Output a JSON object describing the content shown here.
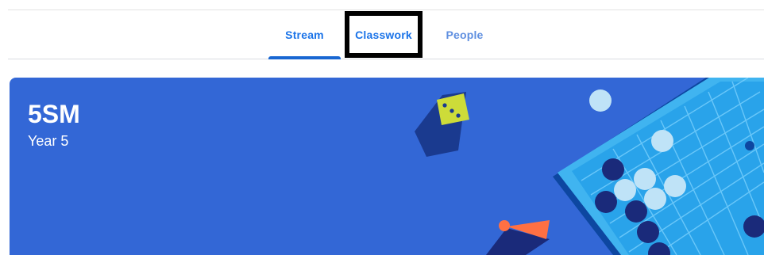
{
  "tabs": [
    {
      "label": "Stream",
      "active": true
    },
    {
      "label": "Classwork",
      "active": false,
      "highlighted": true
    },
    {
      "label": "People",
      "active": false
    }
  ],
  "banner": {
    "title": "5SM",
    "subtitle": "Year 5",
    "background_color": "#3367d6",
    "illustration": "board-game-illustration"
  },
  "colors": {
    "accent": "#1a73e8",
    "active_indicator": "#1967d2",
    "highlight_box": "#000000"
  }
}
